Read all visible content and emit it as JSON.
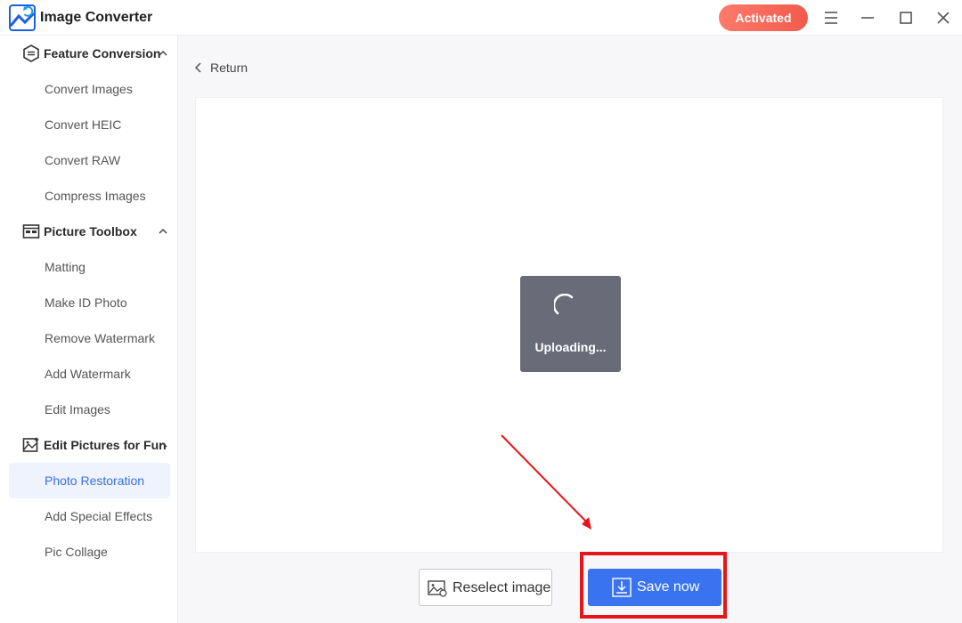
{
  "app": {
    "title": "Image Converter",
    "activated_label": "Activated"
  },
  "sidebar": {
    "groups": [
      {
        "label": "Feature Conversion",
        "icon": "conversion-icon",
        "items": [
          "Convert Images",
          "Convert HEIC",
          "Convert RAW",
          "Compress Images"
        ]
      },
      {
        "label": "Picture Toolbox",
        "icon": "toolbox-icon",
        "items": [
          "Matting",
          "Make ID Photo",
          "Remove Watermark",
          "Add Watermark",
          "Edit Images"
        ]
      },
      {
        "label": "Edit Pictures for Fun",
        "icon": "fun-pictures-icon",
        "items": [
          "Photo Restoration",
          "Add Special Effects",
          "Pic Collage"
        ]
      }
    ],
    "active_item": "Photo Restoration"
  },
  "main": {
    "return_label": "Return",
    "upload_status": "Uploading...",
    "reselect_label": "Reselect image",
    "save_label": "Save now"
  },
  "colors": {
    "accent": "#3a73f0",
    "activated": "#f25a4c",
    "annotation": "#e8141a"
  }
}
